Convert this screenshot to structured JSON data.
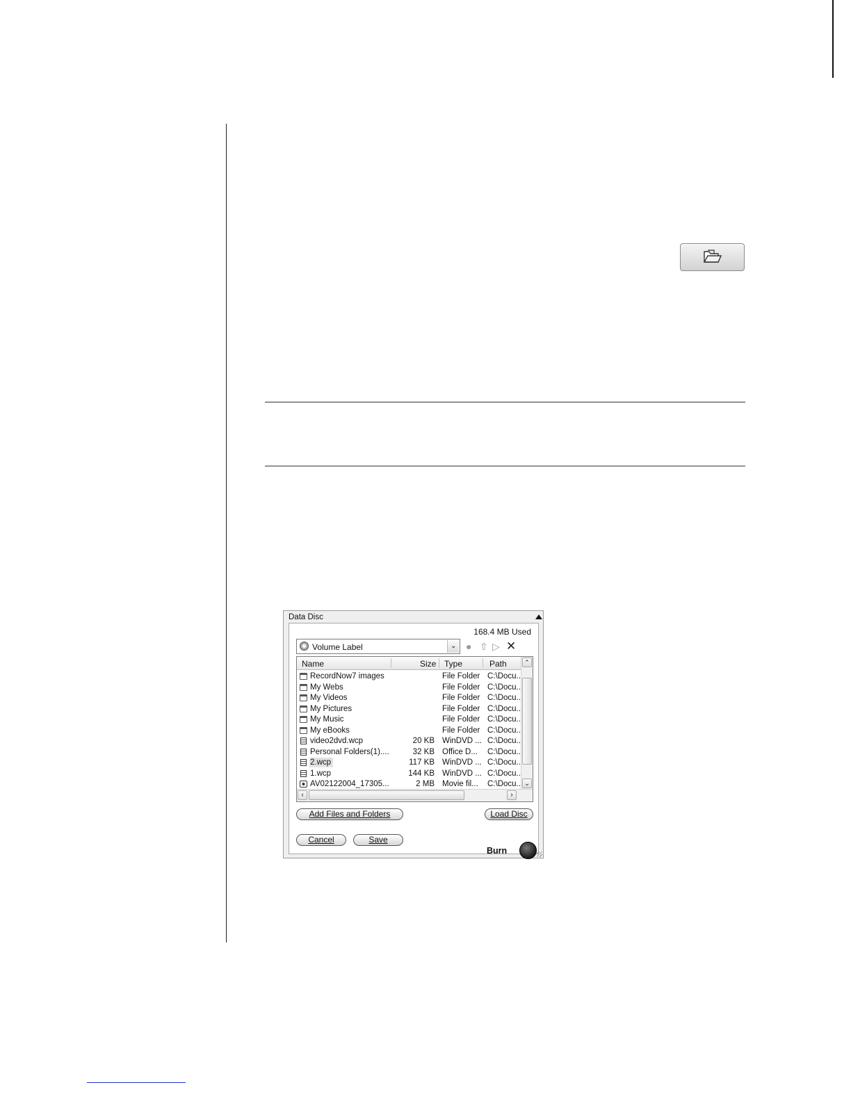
{
  "open_button": {
    "icon": "folder-open-icon"
  },
  "dialog": {
    "title": "Data Disc",
    "usage": "168.4 MB Used",
    "volume_label": "Volume Label",
    "columns": [
      "Name",
      "Size",
      "Type",
      "Path"
    ],
    "rows": [
      {
        "icon": "folder",
        "name": "RecordNow7 images",
        "size": "",
        "type": "File Folder",
        "path": "C:\\Docu..."
      },
      {
        "icon": "folder",
        "name": "My Webs",
        "size": "",
        "type": "File Folder",
        "path": "C:\\Docu..."
      },
      {
        "icon": "folder",
        "name": "My Videos",
        "size": "",
        "type": "File Folder",
        "path": "C:\\Docu..."
      },
      {
        "icon": "folder",
        "name": "My Pictures",
        "size": "",
        "type": "File Folder",
        "path": "C:\\Docu..."
      },
      {
        "icon": "folder",
        "name": "My Music",
        "size": "",
        "type": "File Folder",
        "path": "C:\\Docu..."
      },
      {
        "icon": "folder",
        "name": "My eBooks",
        "size": "",
        "type": "File Folder",
        "path": "C:\\Docu..."
      },
      {
        "icon": "file",
        "name": "video2dvd.wcp",
        "size": "20 KB",
        "type": "WinDVD ...",
        "path": "C:\\Docu..."
      },
      {
        "icon": "file",
        "name": "Personal Folders(1)....",
        "size": "32 KB",
        "type": "Office D...",
        "path": "C:\\Docu..."
      },
      {
        "icon": "file",
        "name": "2.wcp",
        "size": "117 KB",
        "type": "WinDVD ...",
        "path": "C:\\Docu..."
      },
      {
        "icon": "file",
        "name": "1.wcp",
        "size": "144 KB",
        "type": "WinDVD ...",
        "path": "C:\\Docu..."
      },
      {
        "icon": "media",
        "name": "AV02122004_17305...",
        "size": "2 MB",
        "type": "Movie fil...",
        "path": "C:\\Docu..."
      }
    ],
    "buttons": {
      "add": "Add Files and Folders",
      "load": "Load Disc",
      "cancel": "Cancel",
      "save": "Save",
      "burn": "Burn"
    }
  }
}
